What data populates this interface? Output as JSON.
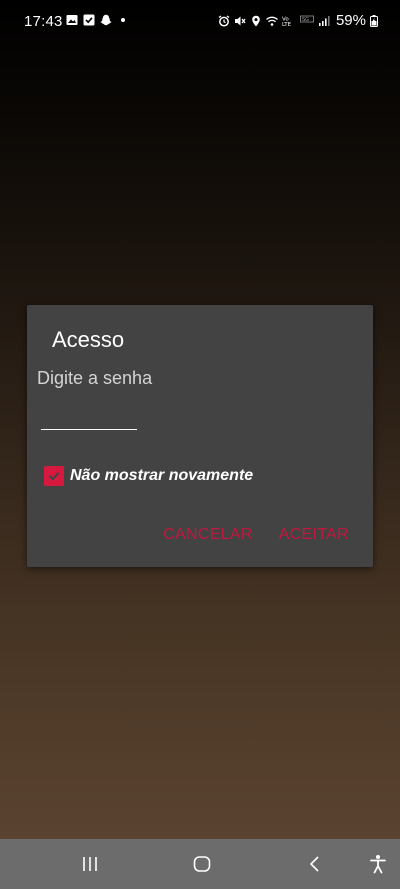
{
  "status_bar": {
    "time": "17:43",
    "battery": "59%",
    "left_icons": [
      "gallery-icon",
      "checkbox-icon",
      "snapchat-icon",
      "dot-icon"
    ],
    "right_icons": [
      "alarm-icon",
      "mute-icon",
      "location-icon",
      "wifi-icon",
      "volte-icon",
      "sos-icon",
      "signal-icon",
      "battery-icon"
    ]
  },
  "dialog": {
    "title": "Acesso",
    "message": "Digite a senha",
    "password_value": "",
    "checkbox_label": "Não mostrar novamente",
    "checkbox_checked": true,
    "cancel_label": "CANCELAR",
    "accept_label": "ACEITAR",
    "accent_color": "#d8193f"
  },
  "nav_bar": {
    "buttons": [
      "recent-apps-icon",
      "home-icon",
      "back-icon",
      "accessibility-icon"
    ]
  }
}
